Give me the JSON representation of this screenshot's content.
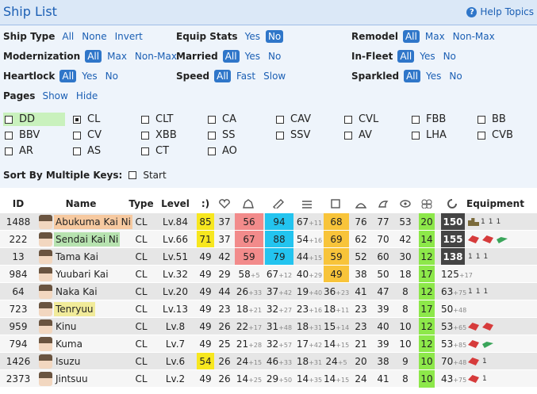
{
  "header": {
    "title": "Ship List",
    "help_label": "Help Topics"
  },
  "filters": {
    "ship_type": {
      "label": "Ship Type",
      "options": [
        "All",
        "None",
        "Invert"
      ]
    },
    "equip_stats": {
      "label": "Equip Stats",
      "options": [
        "Yes",
        "No"
      ],
      "selected": "No"
    },
    "remodel": {
      "label": "Remodel",
      "options": [
        "All",
        "Max",
        "Non-Max"
      ],
      "selected": "All"
    },
    "modernization": {
      "label": "Modernization",
      "options": [
        "All",
        "Max",
        "Non-Max"
      ],
      "selected": "All"
    },
    "married": {
      "label": "Married",
      "options": [
        "All",
        "Yes",
        "No"
      ],
      "selected": "All"
    },
    "in_fleet": {
      "label": "In-Fleet",
      "options": [
        "All",
        "Yes",
        "No"
      ],
      "selected": "All"
    },
    "heartlock": {
      "label": "Heartlock",
      "options": [
        "All",
        "Yes",
        "No"
      ],
      "selected": "All"
    },
    "speed": {
      "label": "Speed",
      "options": [
        "All",
        "Fast",
        "Slow"
      ],
      "selected": "All"
    },
    "sparkled": {
      "label": "Sparkled",
      "options": [
        "All",
        "Yes",
        "No"
      ],
      "selected": "All"
    },
    "pages": {
      "label": "Pages",
      "options": [
        "Show",
        "Hide"
      ]
    }
  },
  "types": [
    {
      "code": "DD",
      "checked": false,
      "hl": true
    },
    {
      "code": "CL",
      "checked": true
    },
    {
      "code": "CLT",
      "checked": false
    },
    {
      "code": "CA",
      "checked": false
    },
    {
      "code": "CAV",
      "checked": false
    },
    {
      "code": "CVL",
      "checked": false
    },
    {
      "code": "FBB",
      "checked": false
    },
    {
      "code": "BB",
      "checked": false
    },
    {
      "code": "BBV",
      "checked": false
    },
    {
      "code": "CV",
      "checked": false
    },
    {
      "code": "XBB",
      "checked": false
    },
    {
      "code": "SS",
      "checked": false
    },
    {
      "code": "SSV",
      "checked": false
    },
    {
      "code": "AV",
      "checked": false
    },
    {
      "code": "LHA",
      "checked": false
    },
    {
      "code": "CVB",
      "checked": false
    },
    {
      "code": "AR",
      "checked": false
    },
    {
      "code": "AS",
      "checked": false
    },
    {
      "code": "CT",
      "checked": false
    },
    {
      "code": "AO",
      "checked": false
    }
  ],
  "sort": {
    "label": "Sort By Multiple Keys:",
    "start_label": "Start"
  },
  "table": {
    "headers": {
      "id": "ID",
      "name": "Name",
      "type": "Type",
      "level": "Level",
      "morale": ":)",
      "equipment": "Equipment"
    },
    "rows": [
      {
        "id": "1488",
        "name": "Abukuma Kai Ni",
        "nhl": "o",
        "type": "CL",
        "level": "Lv.84",
        "mor": "85",
        "morc": "y",
        "hp": "37",
        "fp": "56",
        "fpc": "r",
        "tp": "94",
        "tpc": "b",
        "aa": "67",
        "aab": "+11",
        "ar": "68",
        "arc": "o",
        "asw": "76",
        "ev": "77",
        "los": "53",
        "luck": "20",
        "ac": "150",
        "acc": "d",
        "eq": [
          [
            "tan",
            "1"
          ],
          [
            "",
            "1"
          ],
          [
            "",
            "1"
          ]
        ]
      },
      {
        "id": "222",
        "name": "Sendai Kai Ni",
        "nhl": "g2",
        "type": "CL",
        "level": "Lv.66",
        "mor": "71",
        "morc": "y",
        "hp": "37",
        "fp": "67",
        "fpc": "r",
        "tp": "88",
        "tpc": "b",
        "aa": "54",
        "aab": "+16",
        "ar": "69",
        "arc": "o",
        "asw": "62",
        "ev": "70",
        "los": "42",
        "luck": "14",
        "ac": "155",
        "acc": "d",
        "eq": [
          [
            "red",
            ""
          ],
          [
            "red",
            ""
          ],
          [
            "grn",
            ""
          ]
        ]
      },
      {
        "id": "13",
        "name": "Tama Kai",
        "nhl": "",
        "type": "CL",
        "level": "Lv.51",
        "mor": "49",
        "morc": "",
        "hp": "42",
        "fp": "59",
        "fpc": "r",
        "tp": "79",
        "tpc": "b",
        "aa": "44",
        "aab": "+15",
        "ar": "59",
        "arc": "o",
        "asw": "52",
        "ev": "60",
        "los": "30",
        "luck": "12",
        "ac": "138",
        "acc": "d",
        "eq": [
          [
            "",
            "1"
          ],
          [
            "",
            "1"
          ],
          [
            "",
            "1"
          ]
        ]
      },
      {
        "id": "984",
        "name": "Yuubari Kai",
        "nhl": "",
        "type": "CL",
        "level": "Lv.32",
        "mor": "49",
        "morc": "",
        "hp": "29",
        "fp": "58",
        "fpb": "+5",
        "tp": "67",
        "tpb": "+12",
        "aa": "40",
        "aab": "+29",
        "ar": "49",
        "arc": "o",
        "asw": "38",
        "ev": "50",
        "los": "18",
        "luck": "17",
        "ac": "125",
        "acb": "+17",
        "eq": []
      },
      {
        "id": "64",
        "name": "Naka Kai",
        "nhl": "",
        "type": "CL",
        "level": "Lv.20",
        "mor": "49",
        "morc": "",
        "hp": "44",
        "fp": "26",
        "fpb": "+33",
        "tp": "37",
        "tpb": "+42",
        "aa": "19",
        "aab": "+40",
        "ar": "36",
        "arb": "+23",
        "asw": "41",
        "ev": "47",
        "los": "8",
        "luck": "12",
        "ac": "63",
        "acb": "+75",
        "eq": [
          [
            "",
            "1"
          ],
          [
            "",
            "1"
          ],
          [
            "",
            "1"
          ]
        ]
      },
      {
        "id": "723",
        "name": "Tenryuu",
        "nhl": "y",
        "type": "CL",
        "level": "Lv.13",
        "mor": "49",
        "morc": "",
        "hp": "23",
        "fp": "18",
        "fpb": "+21",
        "tp": "32",
        "tpb": "+27",
        "aa": "23",
        "aab": "+16",
        "ar": "18",
        "arb": "+11",
        "asw": "23",
        "ev": "39",
        "los": "8",
        "luck": "17",
        "ac": "50",
        "acb": "+48",
        "eq": []
      },
      {
        "id": "959",
        "name": "Kinu",
        "nhl": "",
        "type": "CL",
        "level": "Lv.8",
        "mor": "49",
        "morc": "",
        "hp": "26",
        "fp": "22",
        "fpb": "+17",
        "tp": "31",
        "tpb": "+48",
        "aa": "18",
        "aab": "+31",
        "ar": "15",
        "arb": "+14",
        "asw": "23",
        "ev": "40",
        "los": "10",
        "luck": "12",
        "ac": "53",
        "acb": "+65",
        "eq": [
          [
            "red",
            ""
          ],
          [
            "red",
            ""
          ]
        ]
      },
      {
        "id": "794",
        "name": "Kuma",
        "nhl": "",
        "type": "CL",
        "level": "Lv.7",
        "mor": "49",
        "morc": "",
        "hp": "25",
        "fp": "21",
        "fpb": "+28",
        "tp": "32",
        "tpb": "+57",
        "aa": "17",
        "aab": "+42",
        "ar": "14",
        "arb": "+15",
        "asw": "21",
        "ev": "39",
        "los": "10",
        "luck": "12",
        "ac": "53",
        "acb": "+85",
        "eq": [
          [
            "red",
            ""
          ],
          [
            "grn",
            ""
          ]
        ]
      },
      {
        "id": "1426",
        "name": "Isuzu",
        "nhl": "",
        "type": "CL",
        "level": "Lv.6",
        "mor": "54",
        "morc": "y",
        "hp": "26",
        "fp": "24",
        "fpb": "+15",
        "tp": "46",
        "tpb": "+33",
        "aa": "18",
        "aab": "+31",
        "ar": "24",
        "arb": "+5",
        "asw": "20",
        "ev": "38",
        "los": "9",
        "luck": "10",
        "ac": "70",
        "acb": "+48",
        "eq": [
          [
            "red",
            ""
          ],
          [
            "",
            "1"
          ]
        ]
      },
      {
        "id": "2373",
        "name": "Jintsuu",
        "nhl": "",
        "type": "CL",
        "level": "Lv.2",
        "mor": "49",
        "morc": "",
        "hp": "26",
        "fp": "14",
        "fpb": "+25",
        "tp": "29",
        "tpb": "+50",
        "aa": "14",
        "aab": "+35",
        "ar": "14",
        "arb": "+15",
        "asw": "24",
        "ev": "41",
        "los": "8",
        "luck": "10",
        "ac": "43",
        "acb": "+75",
        "eq": [
          [
            "red",
            ""
          ],
          [
            "",
            "1"
          ]
        ]
      }
    ]
  }
}
